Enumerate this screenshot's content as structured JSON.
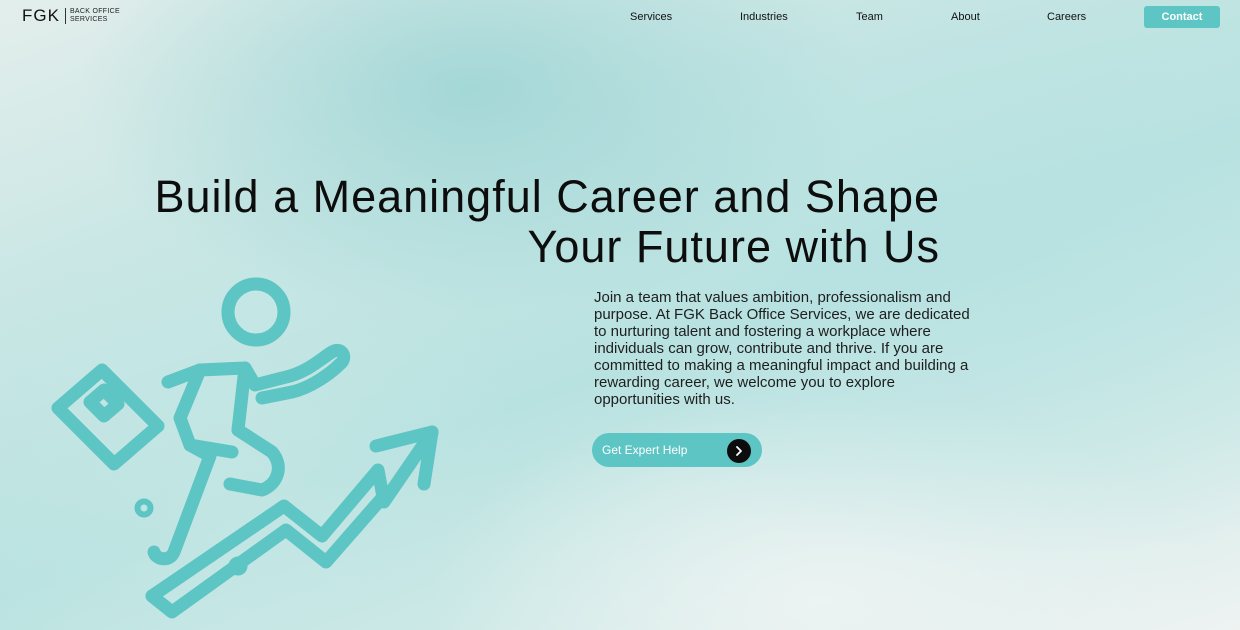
{
  "brand": {
    "mark": "FGK",
    "name_line1": "BACK OFFICE",
    "name_line2": "SERVICES"
  },
  "nav": {
    "items": [
      {
        "label": "Services"
      },
      {
        "label": "Industries"
      },
      {
        "label": "Team"
      },
      {
        "label": "About"
      },
      {
        "label": "Careers"
      }
    ],
    "contact_label": "Contact"
  },
  "hero": {
    "title_line1": "Build a Meaningful Career and Shape",
    "title_line2": "Your Future with Us",
    "description": "Join a team that values ambition, professionalism and purpose. At FGK Back Office Services, we are dedicated to nurturing talent and fostering a workplace where individuals can grow, contribute and thrive. If you are committed to making a meaningful impact and building a rewarding career, we welcome you to explore opportunities with us.",
    "cta_label": "Get Expert Help"
  },
  "icons": {
    "cta_arrow": "chevron-right-icon",
    "illustration": "career-growth-climber-icon"
  },
  "colors": {
    "accent": "#5dc5c4",
    "text": "#111111",
    "cta_arrow_bg": "#0c0c0c"
  }
}
